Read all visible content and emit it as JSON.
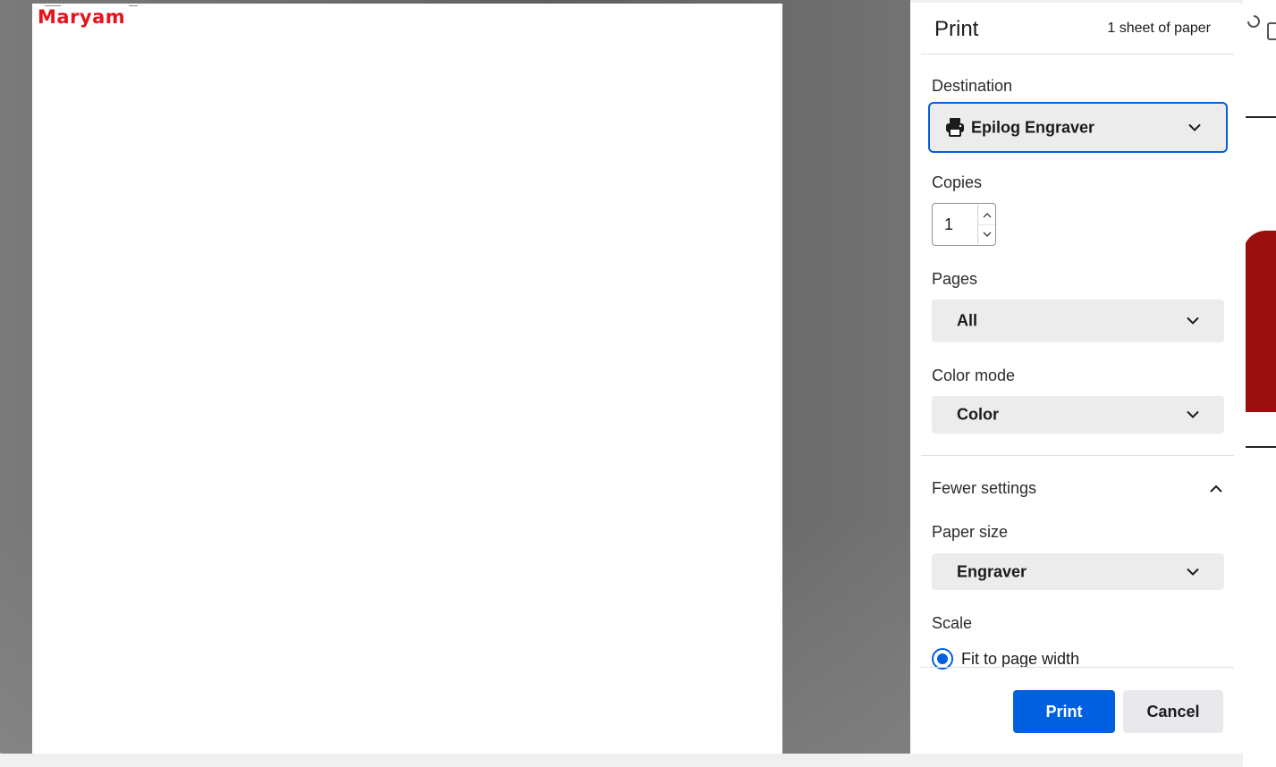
{
  "preview": {
    "page_text": "Maryam"
  },
  "dialog": {
    "title": "Print",
    "sheet_count": "1 sheet of paper",
    "destination": {
      "label": "Destination",
      "value": "Epilog Engraver",
      "icon": "printer-icon"
    },
    "copies": {
      "label": "Copies",
      "value": "1"
    },
    "pages": {
      "label": "Pages",
      "value": "All"
    },
    "color_mode": {
      "label": "Color mode",
      "value": "Color"
    },
    "toggle_settings": {
      "label": "Fewer settings",
      "icon": "chevron-up-icon"
    },
    "paper_size": {
      "label": "Paper size",
      "value": "Engraver"
    },
    "scale": {
      "label": "Scale",
      "option": "Fit to page width",
      "selected": true
    },
    "buttons": {
      "print": "Print",
      "cancel": "Cancel"
    }
  },
  "colors": {
    "accent": "#0060df",
    "preview_text": "#e8141c",
    "background_red": "#9a0e0e"
  }
}
